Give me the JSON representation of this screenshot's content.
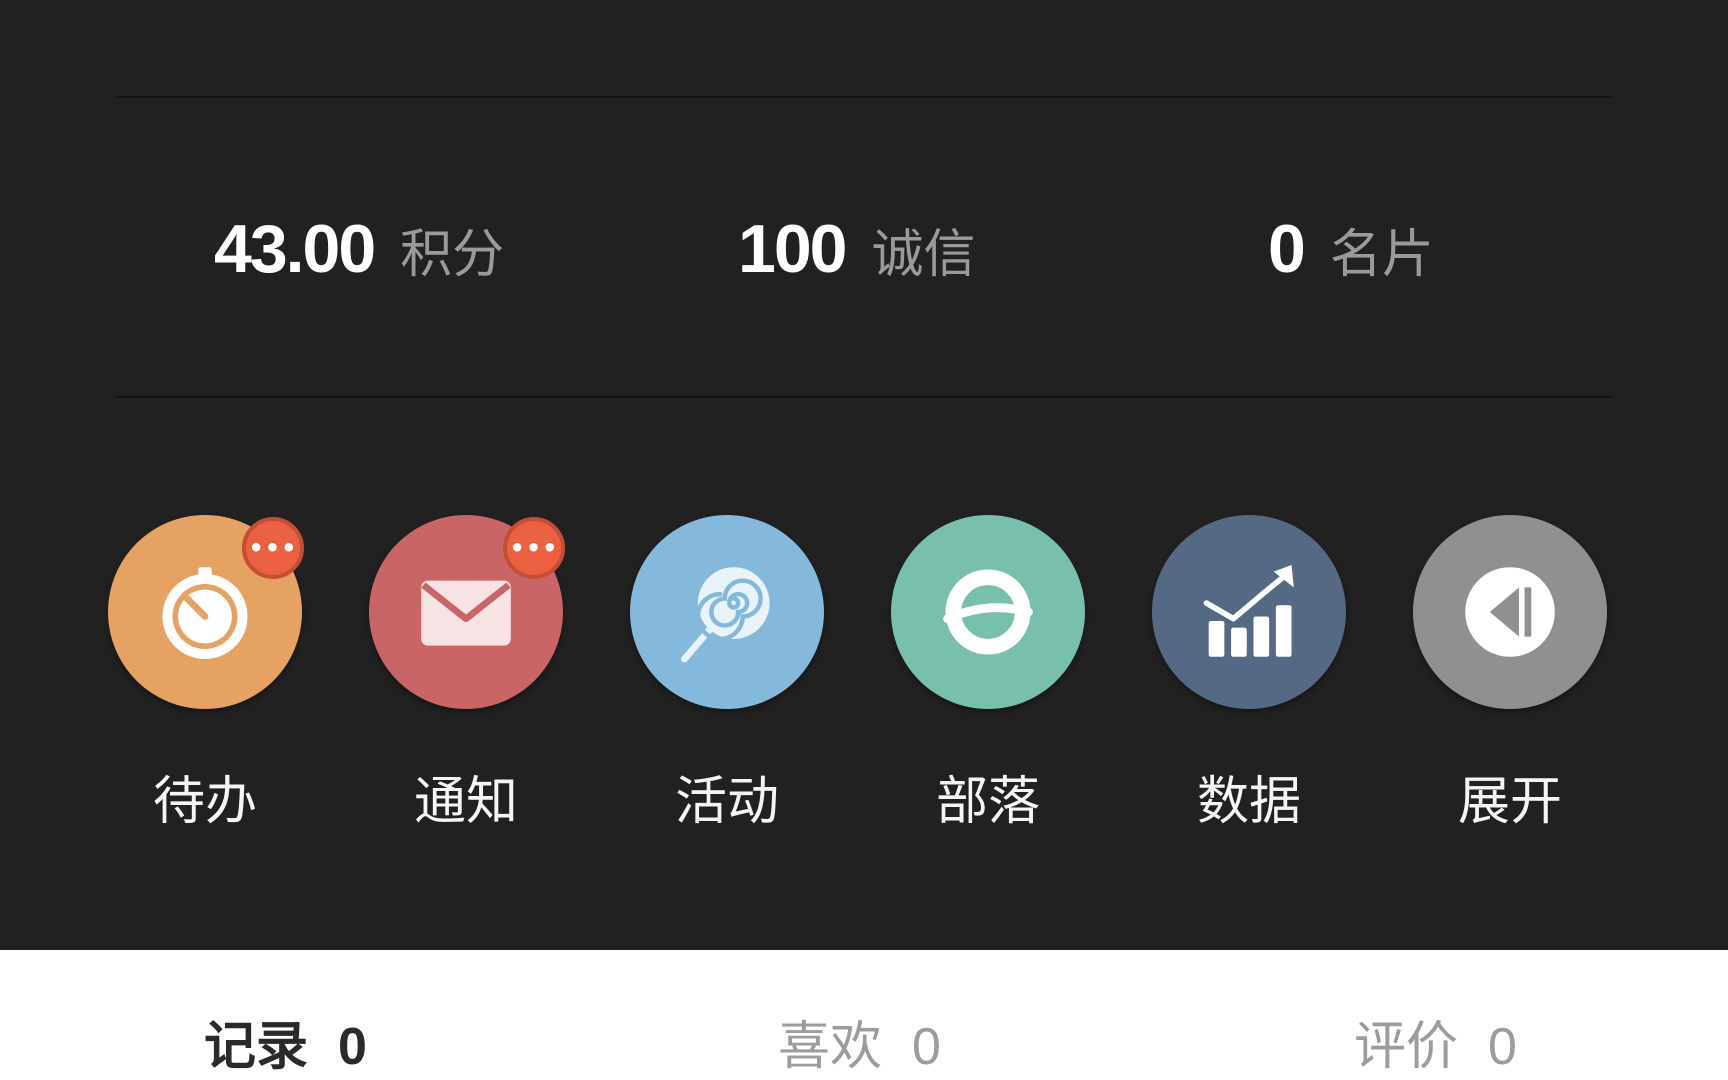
{
  "stats": [
    {
      "value": "43.00",
      "label": "积分"
    },
    {
      "value": "100",
      "label": "诚信"
    },
    {
      "value": "0",
      "label": "名片"
    }
  ],
  "menu": [
    {
      "label": "待办",
      "icon": "timer-icon",
      "color": "#e5a262",
      "badge": "•••"
    },
    {
      "label": "通知",
      "icon": "envelope-icon",
      "color": "#c96566",
      "badge": "•••"
    },
    {
      "label": "活动",
      "icon": "lollipop-icon",
      "color": "#85b9dc",
      "badge": ""
    },
    {
      "label": "部落",
      "icon": "planet-icon",
      "color": "#78bfae",
      "badge": ""
    },
    {
      "label": "数据",
      "icon": "chart-icon",
      "color": "#566984",
      "badge": ""
    },
    {
      "label": "展开",
      "icon": "expand-icon",
      "color": "#909090",
      "badge": ""
    }
  ],
  "tabs": [
    {
      "label": "记录",
      "count": "0",
      "active": true
    },
    {
      "label": "喜欢",
      "count": "0",
      "active": false
    },
    {
      "label": "评价",
      "count": "0",
      "active": false
    }
  ]
}
